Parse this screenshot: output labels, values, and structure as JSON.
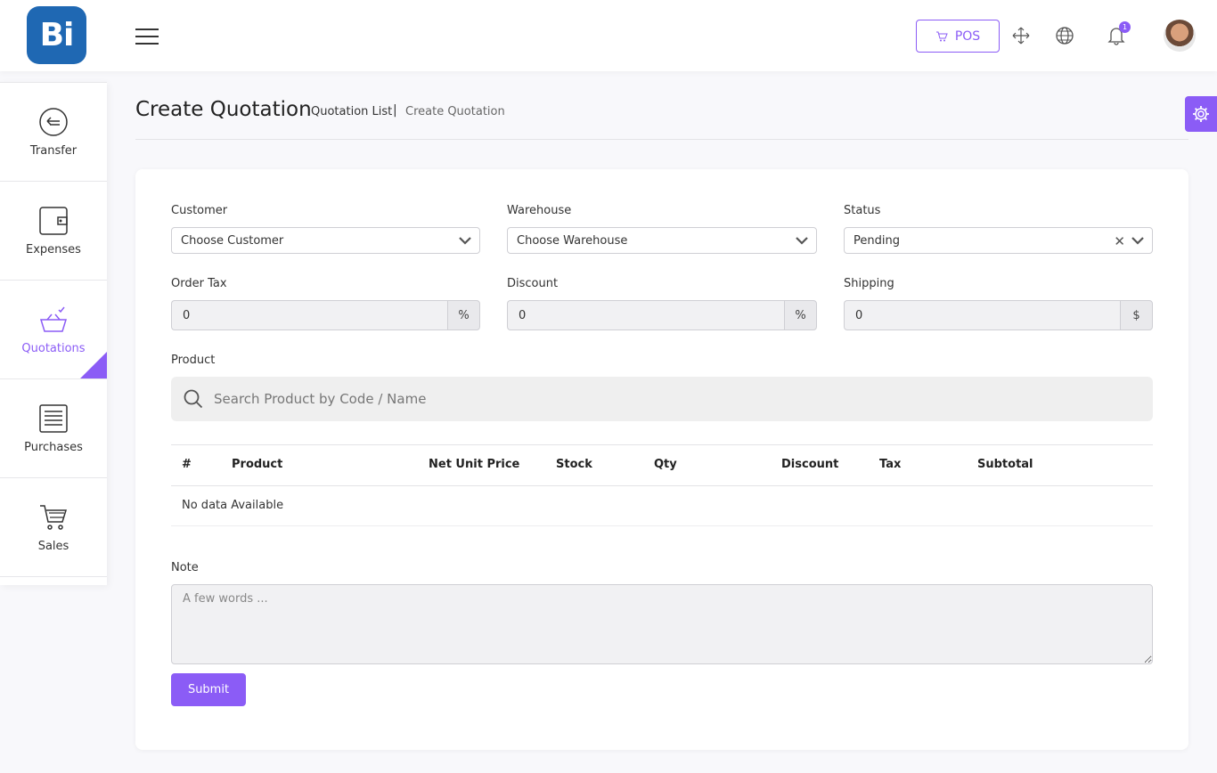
{
  "app": {
    "logo_text": "Bi",
    "brand_color": "#1f68b3",
    "accent_color": "#8b5cf6"
  },
  "topbar": {
    "pos_label": "POS",
    "notification_count": "1"
  },
  "sidebar": {
    "items": [
      {
        "label": "Transfer",
        "icon": "transfer-icon"
      },
      {
        "label": "Expenses",
        "icon": "wallet-icon"
      },
      {
        "label": "Quotations",
        "icon": "basket-icon",
        "active": true
      },
      {
        "label": "Purchases",
        "icon": "receipt-icon"
      },
      {
        "label": "Sales",
        "icon": "cart-icon"
      }
    ]
  },
  "header": {
    "title": "Create Quotation",
    "breadcrumb": [
      "Quotation List",
      "Create Quotation"
    ],
    "separator": "|"
  },
  "form": {
    "customer": {
      "label": "Customer",
      "value": "Choose Customer"
    },
    "warehouse": {
      "label": "Warehouse",
      "value": "Choose Warehouse"
    },
    "status": {
      "label": "Status",
      "value": "Pending"
    },
    "order_tax": {
      "label": "Order Tax",
      "value": "0",
      "unit": "%"
    },
    "discount": {
      "label": "Discount",
      "value": "0",
      "unit": "%"
    },
    "shipping": {
      "label": "Shipping",
      "value": "0",
      "unit": "$"
    },
    "product": {
      "label": "Product",
      "placeholder": "Search Product by Code / Name"
    },
    "note": {
      "label": "Note",
      "placeholder": "A few words ..."
    },
    "submit_label": "Submit"
  },
  "table": {
    "columns": [
      "#",
      "Product",
      "Net Unit Price",
      "Stock",
      "Qty",
      "Discount",
      "Tax",
      "Subtotal"
    ],
    "empty_text": "No data Available"
  }
}
